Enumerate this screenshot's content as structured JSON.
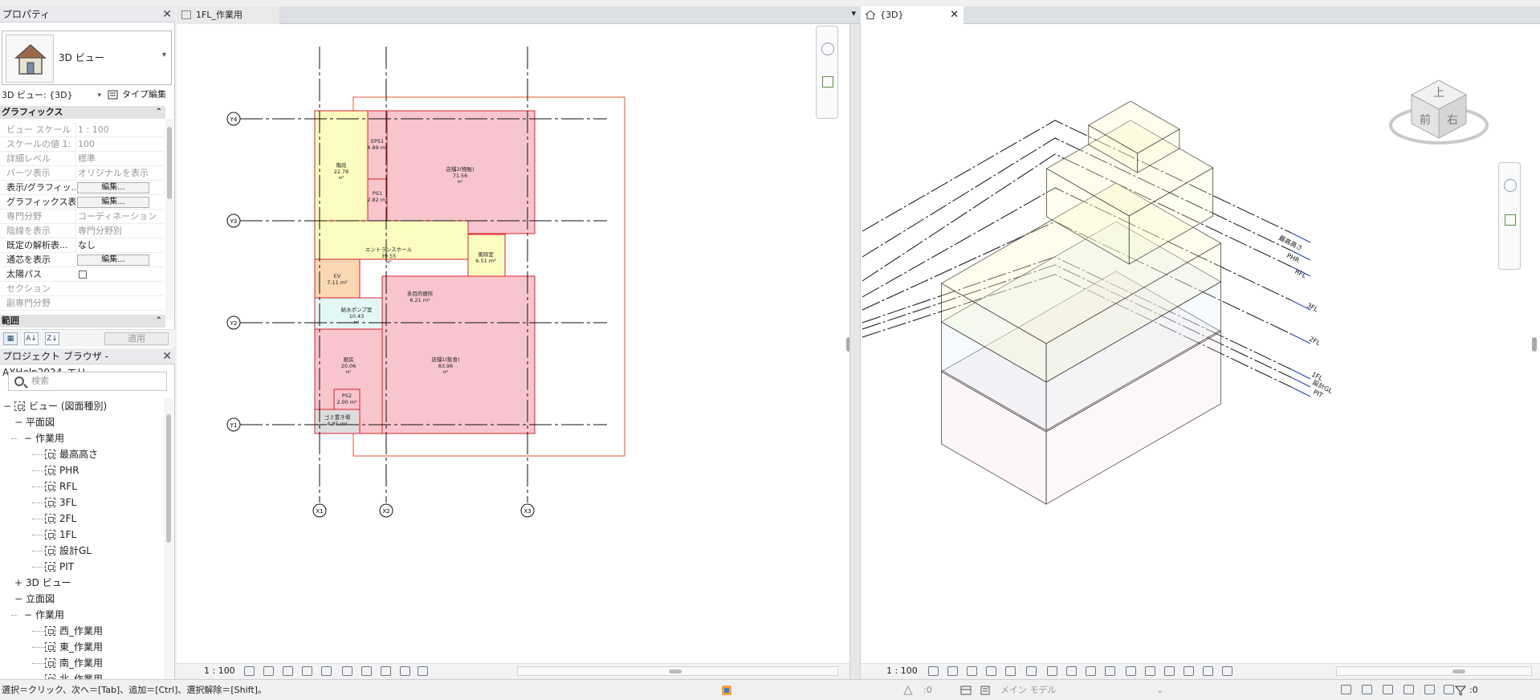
{
  "properties": {
    "title": "プロパティ",
    "type_name": "3D ビュー",
    "view_select": "3D ビュー: {3D}",
    "type_edit": "タイプ編集",
    "section_graphics": "グラフィックス",
    "rows": [
      {
        "key": "ビュー スケール",
        "value": "1 : 100",
        "active": false
      },
      {
        "key": "スケールの値    1:",
        "value": "100",
        "active": false
      },
      {
        "key": "詳細レベル",
        "value": "標準",
        "active": false
      },
      {
        "key": "パーツ表示",
        "value": "オリジナルを表示",
        "active": false
      },
      {
        "key": "表示/グラフィッ...",
        "button": "編集...",
        "active": true
      },
      {
        "key": "グラフィックス表...",
        "button": "編集...",
        "active": true
      },
      {
        "key": "専門分野",
        "value": "コーディネーション",
        "active": false
      },
      {
        "key": "陰線を表示",
        "value": "専門分野別",
        "active": false
      },
      {
        "key": "既定の解析表...",
        "value": "なし",
        "active": true
      },
      {
        "key": "通芯を表示",
        "button": "編集...",
        "active": true
      },
      {
        "key": "太陽パス",
        "checkbox": true,
        "active": true
      },
      {
        "key": "セクション",
        "value": "",
        "active": false
      },
      {
        "key": "副専門分野",
        "value": "",
        "active": false
      }
    ],
    "section_range": "範囲",
    "apply": "適用"
  },
  "browser": {
    "title": "プロジェクト ブラウザ - AXHelp2024_エリ...",
    "search_placeholder": "検索",
    "items": [
      {
        "label": "ビュー (図面種別)",
        "level": 0,
        "expander": "−",
        "icon": true
      },
      {
        "label": "平面図",
        "level": 1,
        "expander": "−"
      },
      {
        "label": "作業用",
        "level": 2,
        "expander": "−"
      },
      {
        "label": "最高高さ",
        "level": 3,
        "icon": true
      },
      {
        "label": "PHR",
        "level": 3,
        "icon": true
      },
      {
        "label": "RFL",
        "level": 3,
        "icon": true
      },
      {
        "label": "3FL",
        "level": 3,
        "icon": true
      },
      {
        "label": "2FL",
        "level": 3,
        "icon": true
      },
      {
        "label": "1FL",
        "level": 3,
        "icon": true
      },
      {
        "label": "設計GL",
        "level": 3,
        "icon": true
      },
      {
        "label": "PIT",
        "level": 3,
        "icon": true
      },
      {
        "label": "3D ビュー",
        "level": 1,
        "expander": "+"
      },
      {
        "label": "立面図",
        "level": 1,
        "expander": "−"
      },
      {
        "label": "作業用",
        "level": 2,
        "expander": "−"
      },
      {
        "label": "西_作業用",
        "level": 3,
        "icon": true
      },
      {
        "label": "東_作業用",
        "level": 3,
        "icon": true
      },
      {
        "label": "南_作業用",
        "level": 3,
        "icon": true
      },
      {
        "label": "北_作業用",
        "level": 3,
        "icon": true
      }
    ]
  },
  "plan_view": {
    "tab": "1FL_作業用",
    "scale": "1 : 100",
    "grids_vertical": [
      "X1",
      "X2",
      "X3"
    ],
    "grids_horizontal": [
      "Y4",
      "Y3",
      "Y2",
      "Y1"
    ],
    "rooms": [
      {
        "name": "階段",
        "area": "22.78",
        "unit": "m²"
      },
      {
        "name": "EPS1",
        "area": "4.89 m²"
      },
      {
        "name": "店舗2(物販)",
        "area": "71.56",
        "unit": "m²"
      },
      {
        "name": "PS1",
        "area": "2.82 m²"
      },
      {
        "name": "エントランスホール",
        "area": "39.55",
        "unit": "m²"
      },
      {
        "name": "風除室",
        "area": "6.51 m²"
      },
      {
        "name": "EV",
        "area": "7.11 m²"
      },
      {
        "name": "多目的便所",
        "area": "6.21 m²"
      },
      {
        "name": "給水ポンプ室",
        "area": "10.43",
        "unit": "m²"
      },
      {
        "name": "厨房",
        "area": "20.06",
        "unit": "m²"
      },
      {
        "name": "店舗1(飲食)",
        "area": "83.96",
        "unit": "m²"
      },
      {
        "name": "PS2",
        "area": "2.00 m²"
      },
      {
        "name": "ゴミ置き場",
        "area": "4.85 m²"
      }
    ]
  },
  "view_3d": {
    "tab": "{3D}",
    "scale": "1 : 100",
    "levels": [
      "最高高さ",
      "PHR",
      "RFL",
      "3FL",
      "2FL",
      "1FL",
      "設計GL",
      "PIT"
    ],
    "viewcube_faces": [
      "上",
      "前",
      "右"
    ]
  },
  "status": {
    "text": "選択＝クリック、次へ＝[Tab]、追加＝[Ctrl]、選択解除＝[Shift]。",
    "zero": ":0",
    "workset": "メイン モデル",
    "filter_count": ":0"
  },
  "colors": {
    "room_pink": "#f7c5cb",
    "room_yellow": "#fcfcc0",
    "room_orange": "#fbd7b2",
    "room_cyan": "#e3f7f4",
    "room_gray": "#dddddd",
    "room_border": "#d9232f",
    "crop_border": "#e45a2a",
    "level_blue": "#1f3fbf"
  }
}
